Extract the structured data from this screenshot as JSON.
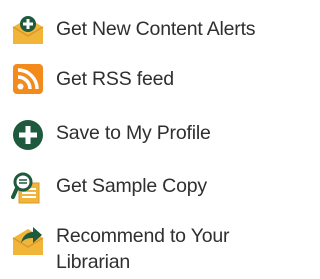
{
  "menu": {
    "items": [
      {
        "label": "Get New Content Alerts",
        "icon": "envelope-plus-icon"
      },
      {
        "label": "Get RSS feed",
        "icon": "rss-icon"
      },
      {
        "label": "Save to My Profile",
        "icon": "plus-circle-icon"
      },
      {
        "label": "Get Sample Copy",
        "icon": "sample-copy-icon"
      },
      {
        "label": "Recommend to Your Librarian",
        "icon": "envelope-arrow-icon"
      }
    ]
  },
  "colors": {
    "envelope": "#f1b53a",
    "envelope_dark": "#d99a2b",
    "rss_orange": "#f28a1c",
    "green": "#1f5a3f",
    "text": "#2f2f2f"
  }
}
